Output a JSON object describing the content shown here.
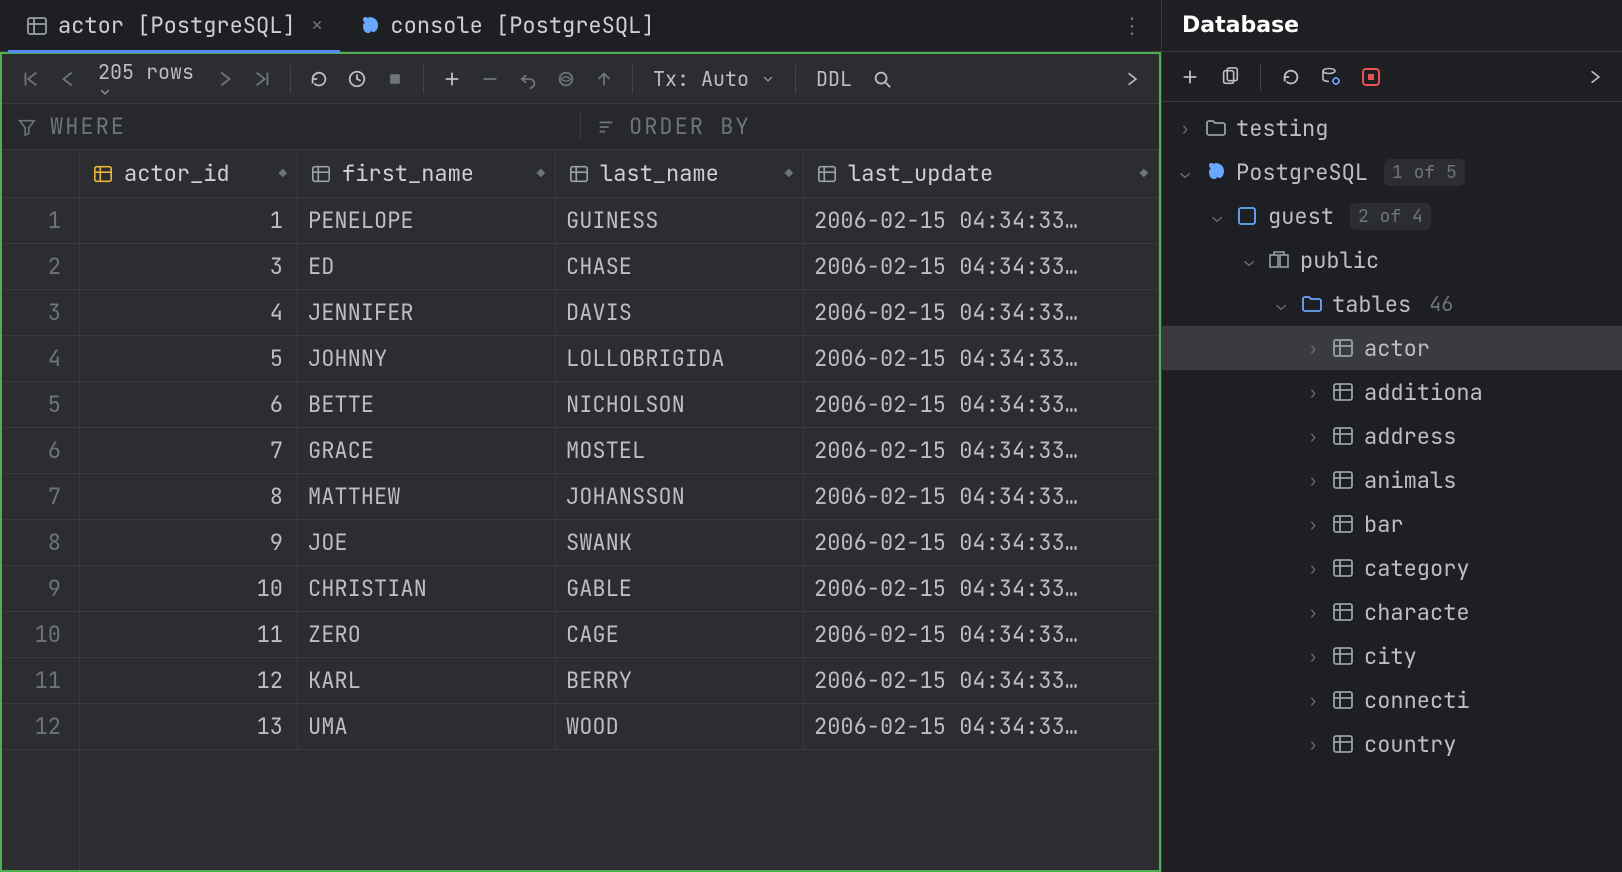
{
  "tabs": [
    {
      "icon": "table-icon",
      "label": "actor [PostgreSQL]",
      "active": true,
      "closable": true
    },
    {
      "icon": "postgres-icon",
      "label": "console [PostgreSQL]",
      "active": false,
      "closable": false
    }
  ],
  "toolbar": {
    "row_count": "205 rows",
    "tx_label": "Tx: Auto",
    "ddl_label": "DDL"
  },
  "filter": {
    "where_label": "WHERE",
    "order_label": "ORDER BY"
  },
  "columns": [
    {
      "name": "actor_id",
      "icon": "pk"
    },
    {
      "name": "first_name",
      "icon": "col"
    },
    {
      "name": "last_name",
      "icon": "col"
    },
    {
      "name": "last_update",
      "icon": "col"
    }
  ],
  "rows": [
    {
      "n": 1,
      "actor_id": 1,
      "first_name": "PENELOPE",
      "last_name": "GUINESS",
      "last_update": "2006-02-15 04:34:33…"
    },
    {
      "n": 2,
      "actor_id": 3,
      "first_name": "ED",
      "last_name": "CHASE",
      "last_update": "2006-02-15 04:34:33…"
    },
    {
      "n": 3,
      "actor_id": 4,
      "first_name": "JENNIFER",
      "last_name": "DAVIS",
      "last_update": "2006-02-15 04:34:33…"
    },
    {
      "n": 4,
      "actor_id": 5,
      "first_name": "JOHNNY",
      "last_name": "LOLLOBRIGIDA",
      "last_update": "2006-02-15 04:34:33…"
    },
    {
      "n": 5,
      "actor_id": 6,
      "first_name": "BETTE",
      "last_name": "NICHOLSON",
      "last_update": "2006-02-15 04:34:33…"
    },
    {
      "n": 6,
      "actor_id": 7,
      "first_name": "GRACE",
      "last_name": "MOSTEL",
      "last_update": "2006-02-15 04:34:33…"
    },
    {
      "n": 7,
      "actor_id": 8,
      "first_name": "MATTHEW",
      "last_name": "JOHANSSON",
      "last_update": "2006-02-15 04:34:33…"
    },
    {
      "n": 8,
      "actor_id": 9,
      "first_name": "JOE",
      "last_name": "SWANK",
      "last_update": "2006-02-15 04:34:33…"
    },
    {
      "n": 9,
      "actor_id": 10,
      "first_name": "CHRISTIAN",
      "last_name": "GABLE",
      "last_update": "2006-02-15 04:34:33…"
    },
    {
      "n": 10,
      "actor_id": 11,
      "first_name": "ZERO",
      "last_name": "CAGE",
      "last_update": "2006-02-15 04:34:33…"
    },
    {
      "n": 11,
      "actor_id": 12,
      "first_name": "KARL",
      "last_name": "BERRY",
      "last_update": "2006-02-15 04:34:33…"
    },
    {
      "n": 12,
      "actor_id": 13,
      "first_name": "UMA",
      "last_name": "WOOD",
      "last_update": "2006-02-15 04:34:33…"
    }
  ],
  "dbpanel": {
    "title": "Database",
    "tree": [
      {
        "depth": 0,
        "chev": "right",
        "icon": "folder",
        "label": "testing"
      },
      {
        "depth": 0,
        "chev": "down",
        "icon": "postgres",
        "label": "PostgreSQL",
        "badge": "1 of 5"
      },
      {
        "depth": 1,
        "chev": "down",
        "icon": "schema",
        "label": "guest",
        "badge": "2 of 4"
      },
      {
        "depth": 2,
        "chev": "down",
        "icon": "namespace",
        "label": "public"
      },
      {
        "depth": 3,
        "chev": "down",
        "icon": "folder-tables",
        "label": "tables",
        "count": "46"
      },
      {
        "depth": 4,
        "chev": "right",
        "icon": "table",
        "label": "actor",
        "selected": true
      },
      {
        "depth": 4,
        "chev": "right",
        "icon": "table",
        "label": "additiona"
      },
      {
        "depth": 4,
        "chev": "right",
        "icon": "table",
        "label": "address"
      },
      {
        "depth": 4,
        "chev": "right",
        "icon": "table",
        "label": "animals"
      },
      {
        "depth": 4,
        "chev": "right",
        "icon": "table",
        "label": "bar"
      },
      {
        "depth": 4,
        "chev": "right",
        "icon": "table",
        "label": "category"
      },
      {
        "depth": 4,
        "chev": "right",
        "icon": "table",
        "label": "characte"
      },
      {
        "depth": 4,
        "chev": "right",
        "icon": "table",
        "label": "city"
      },
      {
        "depth": 4,
        "chev": "right",
        "icon": "table",
        "label": "connecti"
      },
      {
        "depth": 4,
        "chev": "right",
        "icon": "table",
        "label": "country"
      }
    ]
  }
}
